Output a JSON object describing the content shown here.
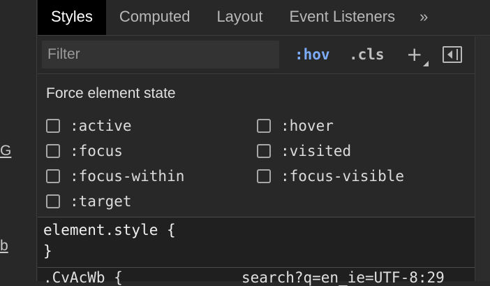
{
  "gutter": {
    "items": [
      "G",
      "b"
    ]
  },
  "tabs": [
    {
      "label": "Styles"
    },
    {
      "label": "Computed"
    },
    {
      "label": "Layout"
    },
    {
      "label": "Event Listeners"
    }
  ],
  "tabs_more_label": "»",
  "toolbar": {
    "filter_placeholder": "Filter",
    "hov_label": ":hov",
    "cls_label": ".cls",
    "plus_label": "+",
    "icons": [
      "new-style-rule-icon",
      "toggle-sidebar-icon"
    ]
  },
  "force_state": {
    "title": "Force element state",
    "states": [
      {
        "label": ":active",
        "checked": false
      },
      {
        "label": ":hover",
        "checked": false
      },
      {
        "label": ":focus",
        "checked": false
      },
      {
        "label": ":visited",
        "checked": false
      },
      {
        "label": ":focus-within",
        "checked": false
      },
      {
        "label": ":focus-visible",
        "checked": false
      },
      {
        "label": ":target",
        "checked": false
      }
    ]
  },
  "rules": {
    "element_style_open": "element.style {",
    "element_style_close": "}",
    "next_selector": ".CvAcWb {",
    "next_source": "search?q=en_ie=UTF-8:29"
  },
  "colors": {
    "background": "#282828",
    "accent_hov": "#7cacf8",
    "active_tab": "#000000"
  }
}
